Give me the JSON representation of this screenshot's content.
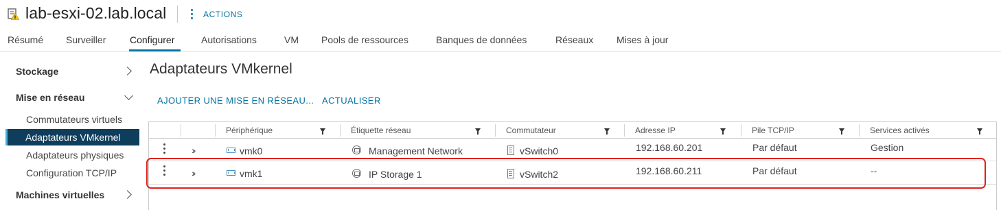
{
  "header": {
    "host_name": "lab-esxi-02.lab.local",
    "actions_label": "ACTIONS",
    "host_icon": "host-warning-icon",
    "actions_icon": "kebab-vertical-icon"
  },
  "tabs": [
    {
      "label": "Résumé"
    },
    {
      "label": "Surveiller"
    },
    {
      "label": "Configurer",
      "active": true
    },
    {
      "label": "Autorisations"
    },
    {
      "label": "VM"
    },
    {
      "label": "Pools de ressources"
    },
    {
      "label": "Banques de données"
    },
    {
      "label": "Réseaux"
    },
    {
      "label": "Mises à jour"
    }
  ],
  "sidebar": {
    "sections": [
      {
        "label": "Stockage",
        "expanded": false
      },
      {
        "label": "Mise en réseau",
        "expanded": true
      },
      {
        "label": "Machines virtuelles",
        "expanded": false
      }
    ],
    "network_items": [
      {
        "label": "Commutateurs virtuels"
      },
      {
        "label": "Adaptateurs VMkernel",
        "active": true
      },
      {
        "label": "Adaptateurs physiques"
      },
      {
        "label": "Configuration TCP/IP"
      }
    ]
  },
  "main": {
    "title": "Adaptateurs VMkernel",
    "toolbar": {
      "add_label": "AJOUTER UNE MISE EN RÉSEAU...",
      "refresh_label": "ACTUALISER"
    }
  },
  "grid": {
    "columns": [
      "Périphérique",
      "Étiquette réseau",
      "Commutateur",
      "Adresse IP",
      "Pile TCP/IP",
      "Services activés"
    ],
    "rows": [
      {
        "device": "vmk0",
        "label": "Management Network",
        "switch": "vSwitch0",
        "ip": "192.168.60.201",
        "stack": "Par défaut",
        "services": "Gestion"
      },
      {
        "device": "vmk1",
        "label": "IP Storage 1",
        "switch": "vSwitch2",
        "ip": "192.168.60.211",
        "stack": "Par défaut",
        "services": "--",
        "highlighted": true
      }
    ]
  },
  "colors": {
    "accent": "#0072a3",
    "sidebar_active_bg": "#0f3d5c",
    "highlight_border": "#e0201c"
  }
}
